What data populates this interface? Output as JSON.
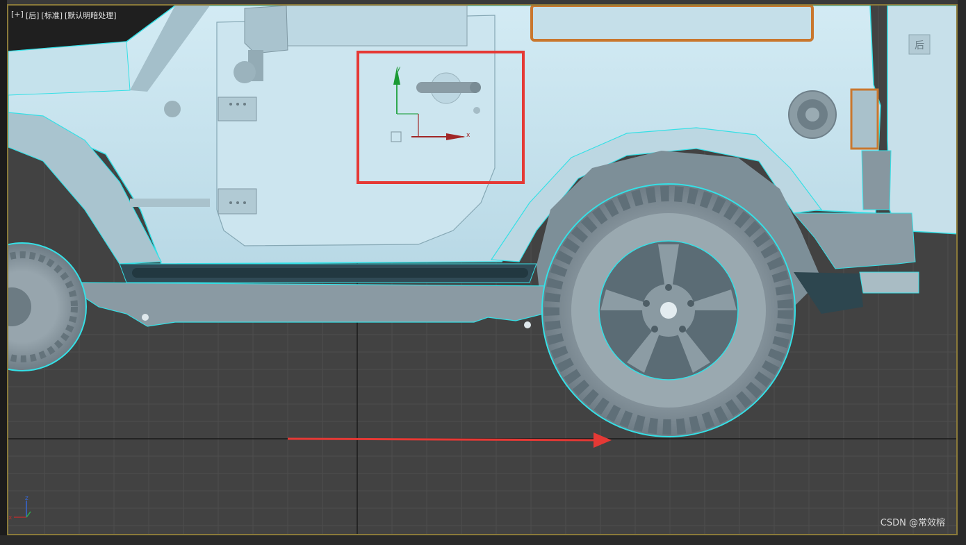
{
  "viewport": {
    "labels": [
      "[+]",
      "[后]",
      "[标准]",
      "[默认明暗处理]"
    ]
  },
  "gizmo": {
    "x_label": "x",
    "y_label": "y"
  },
  "tripod": {
    "x_label": "x",
    "z_label": "z"
  },
  "rear_label": "后",
  "watermark": "CSDN @常效榕",
  "colors": {
    "body": "#c7e3ee",
    "outline": "#35e0e6",
    "tire": "#8c9aa3",
    "grid": "#555555",
    "annotation": "#e53935",
    "selection_orange": "#c9772e"
  }
}
